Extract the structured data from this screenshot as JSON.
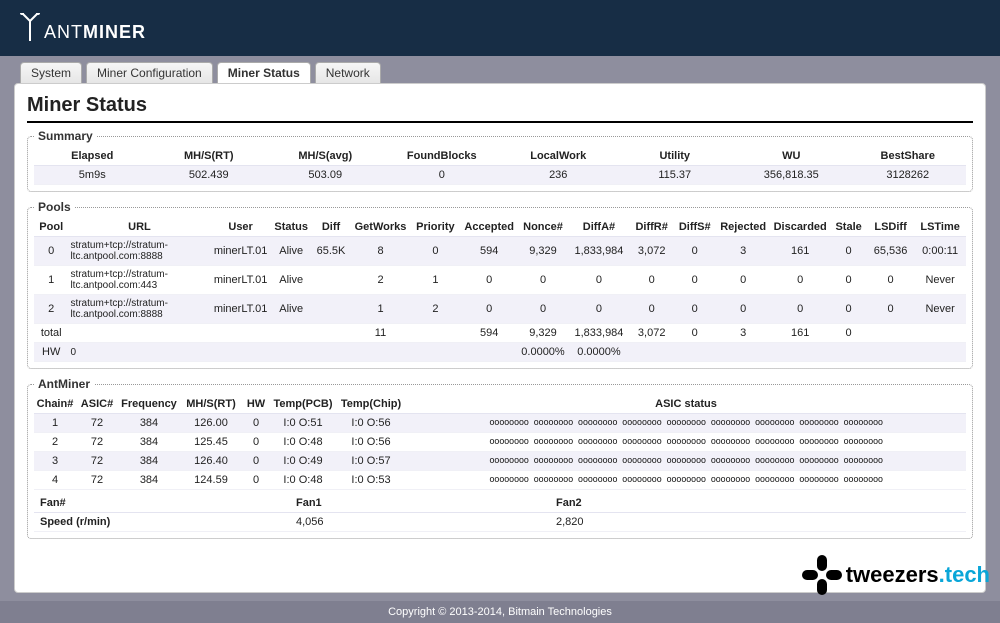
{
  "brand": {
    "name_thin": "ANT",
    "name_bold": "MINER"
  },
  "tabs": [
    {
      "label": "System"
    },
    {
      "label": "Miner Configuration"
    },
    {
      "label": "Miner Status",
      "active": true
    },
    {
      "label": "Network"
    }
  ],
  "page_title": "Miner Status",
  "summary": {
    "legend": "Summary",
    "headers": [
      "Elapsed",
      "MH/S(RT)",
      "MH/S(avg)",
      "FoundBlocks",
      "LocalWork",
      "Utility",
      "WU",
      "BestShare"
    ],
    "row": [
      "5m9s",
      "502.439",
      "503.09",
      "0",
      "236",
      "115.37",
      "356,818.35",
      "3128262"
    ]
  },
  "pools": {
    "legend": "Pools",
    "headers": [
      "Pool",
      "URL",
      "User",
      "Status",
      "Diff",
      "GetWorks",
      "Priority",
      "Accepted",
      "Nonce#",
      "DiffA#",
      "DiffR#",
      "DiffS#",
      "Rejected",
      "Discarded",
      "Stale",
      "LSDiff",
      "LSTime"
    ],
    "rows": [
      [
        "0",
        "stratum+tcp://stratum-ltc.antpool.com:8888",
        "minerLT.01",
        "Alive",
        "65.5K",
        "8",
        "0",
        "594",
        "9,329",
        "1,833,984",
        "3,072",
        "0",
        "3",
        "161",
        "0",
        "65,536",
        "0:00:11"
      ],
      [
        "1",
        "stratum+tcp://stratum-ltc.antpool.com:443",
        "minerLT.01",
        "Alive",
        "",
        "2",
        "1",
        "0",
        "0",
        "0",
        "0",
        "0",
        "0",
        "0",
        "0",
        "0",
        "Never"
      ],
      [
        "2",
        "stratum+tcp://stratum-ltc.antpool.com:8888",
        "minerLT.01",
        "Alive",
        "",
        "1",
        "2",
        "0",
        "0",
        "0",
        "0",
        "0",
        "0",
        "0",
        "0",
        "0",
        "Never"
      ],
      [
        "total",
        "",
        "",
        "",
        "",
        "11",
        "",
        "594",
        "9,329",
        "1,833,984",
        "3,072",
        "0",
        "3",
        "161",
        "0",
        "",
        ""
      ],
      [
        "HW",
        "0",
        "",
        "",
        "",
        "",
        "",
        "",
        "0.0000%",
        "0.0000%",
        "",
        "",
        "",
        "",
        "",
        "",
        ""
      ]
    ]
  },
  "antminer": {
    "legend": "AntMiner",
    "headers": [
      "Chain#",
      "ASIC#",
      "Frequency",
      "MH/S(RT)",
      "HW",
      "Temp(PCB)",
      "Temp(Chip)",
      "ASIC status"
    ],
    "rows": [
      [
        "1",
        "72",
        "384",
        "126.00",
        "0",
        "I:0 O:51",
        "I:0 O:56",
        "oooooooo oooooooo oooooooo oooooooo oooooooo oooooooo oooooooo oooooooo oooooooo"
      ],
      [
        "2",
        "72",
        "384",
        "125.45",
        "0",
        "I:0 O:48",
        "I:0 O:56",
        "oooooooo oooooooo oooooooo oooooooo oooooooo oooooooo oooooooo oooooooo oooooooo"
      ],
      [
        "3",
        "72",
        "384",
        "126.40",
        "0",
        "I:0 O:49",
        "I:0 O:57",
        "oooooooo oooooooo oooooooo oooooooo oooooooo oooooooo oooooooo oooooooo oooooooo"
      ],
      [
        "4",
        "72",
        "384",
        "124.59",
        "0",
        "I:0 O:48",
        "I:0 O:53",
        "oooooooo oooooooo oooooooo oooooooo oooooooo oooooooo oooooooo oooooooo oooooooo"
      ]
    ],
    "fan_headers": [
      "Fan#",
      "Fan1",
      "Fan2"
    ],
    "fan_row": [
      "Speed (r/min)",
      "4,056",
      "2,820"
    ]
  },
  "footer": "Copyright © 2013-2014, Bitmain Technologies",
  "watermark": {
    "a": "tweezers",
    "b": ".tech"
  }
}
